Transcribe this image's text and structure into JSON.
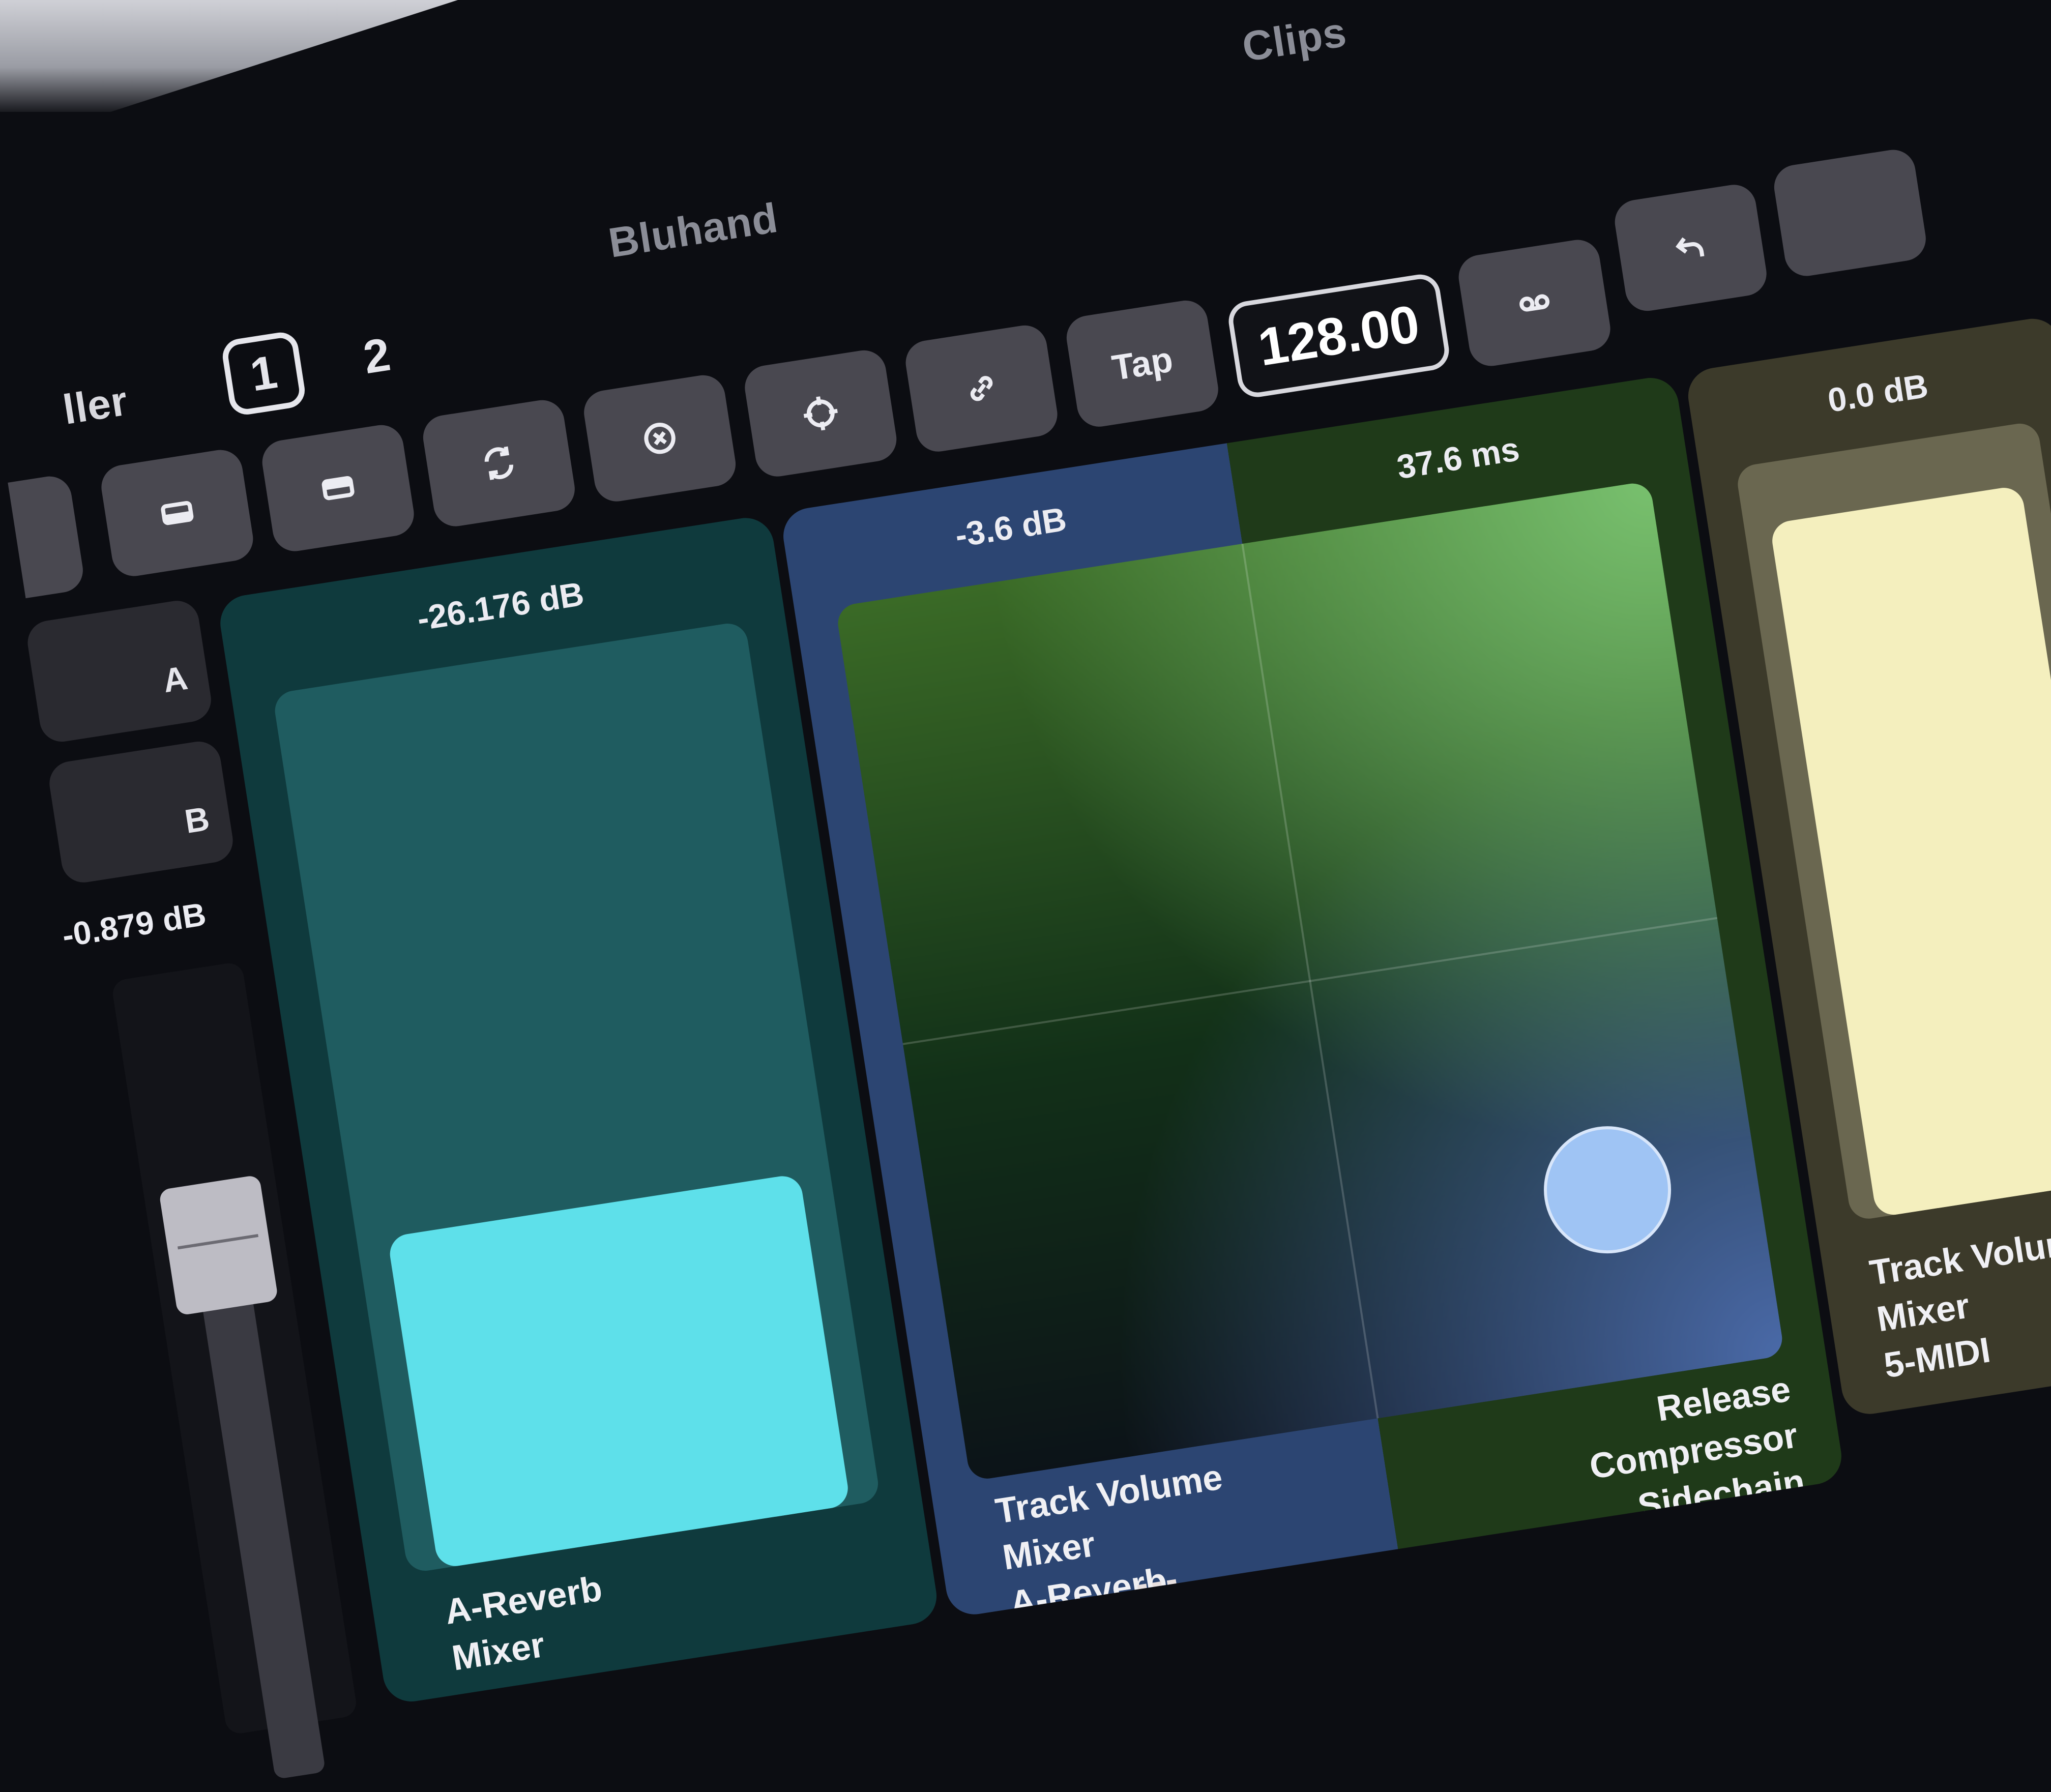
{
  "header": {
    "clips_title": "Clips",
    "project_title": "Bluhand",
    "partial_title": "ller",
    "page_active": "1",
    "page_other": "2",
    "tap_label": "Tap",
    "tempo": "128.00"
  },
  "side": {
    "a_label": "A",
    "b_label": "B",
    "crossfader_value": "-0.879 dB"
  },
  "controls": [
    {
      "value": "-26.176 dB",
      "label_lines": [
        "A-Reverb",
        "Mixer"
      ],
      "level": 0.3,
      "color": "#5ee0ea"
    },
    {
      "type": "xy-pad",
      "x_value": "-3.6 dB",
      "y_value": "37.6 ms",
      "x_label_lines": [
        "Track Volume",
        "Mixer",
        "A-Reverb"
      ],
      "y_label_lines": [
        "Release",
        "Compressor",
        "Sidechain"
      ],
      "x_color": "#2c4572",
      "y_color": "#1f3a19",
      "puck_color": "#9fc4f4"
    },
    {
      "value": "0.0 dB",
      "label_lines": [
        "Track Volume",
        "Mixer",
        "5-MIDI"
      ],
      "level": 0.95,
      "color": "#f4efbe"
    }
  ],
  "empty_slot_label": "---",
  "icons": [
    "square-icon",
    "square-icon",
    "refresh-icon",
    "close-circle-icon",
    "target-icon",
    "link-icon",
    "loop-icon",
    "undo-icon"
  ],
  "colors": {
    "background": "#0c0d12",
    "button": "#494850",
    "empty_red": "#5a0a12"
  }
}
